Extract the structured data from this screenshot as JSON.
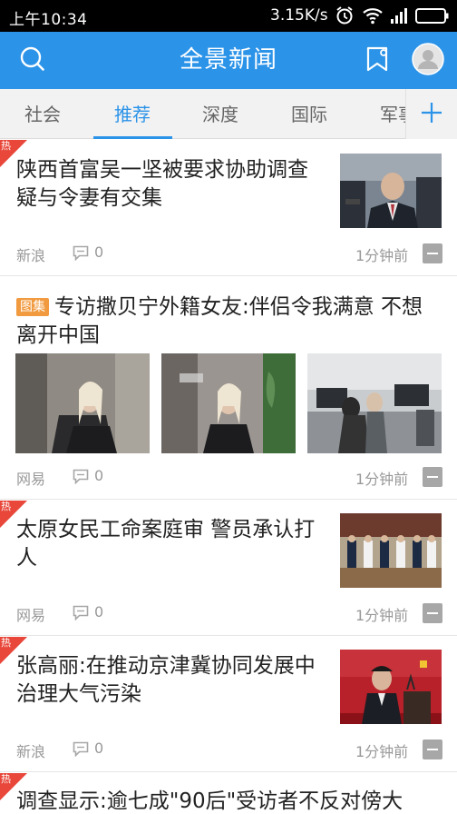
{
  "status_bar": {
    "time": "上午10:34",
    "network_speed": "3.15K/s",
    "icons": [
      "alarm-icon",
      "wifi-icon",
      "signal-icon",
      "battery-icon"
    ]
  },
  "header": {
    "title": "全景新闻",
    "accent_color": "#2b93e8",
    "icons": [
      "search-icon",
      "bookmark-icon",
      "avatar-icon"
    ]
  },
  "tabs": {
    "items": [
      {
        "label": "社会"
      },
      {
        "label": "推荐"
      },
      {
        "label": "深度"
      },
      {
        "label": "国际"
      },
      {
        "label": "军事"
      }
    ],
    "active_index": 1,
    "add_icon": "plus-icon"
  },
  "feed": {
    "hot_badge_label": "热",
    "hot_color": "#e8473a",
    "articles": [
      {
        "title": "陕西首富吴一坚被要求协助调查疑与令妻有交集",
        "source": "新浪",
        "comments": "0",
        "time": "1分钟前",
        "hot": true
      },
      {
        "tag": "图集",
        "title": "专访撒贝宁外籍女友:伴侣令我满意 不想离开中国",
        "source": "网易",
        "comments": "0",
        "time": "1分钟前",
        "hot": false
      },
      {
        "title": "太原女民工命案庭审 警员承认打人",
        "source": "网易",
        "comments": "0",
        "time": "1分钟前",
        "hot": true
      },
      {
        "title": "张高丽:在推动京津冀协同发展中治理大气污染",
        "source": "新浪",
        "comments": "0",
        "time": "1分钟前",
        "hot": true
      },
      {
        "title": "调查显示:逾七成\"90后\"受访者不反对傍大",
        "hot": true
      }
    ]
  }
}
